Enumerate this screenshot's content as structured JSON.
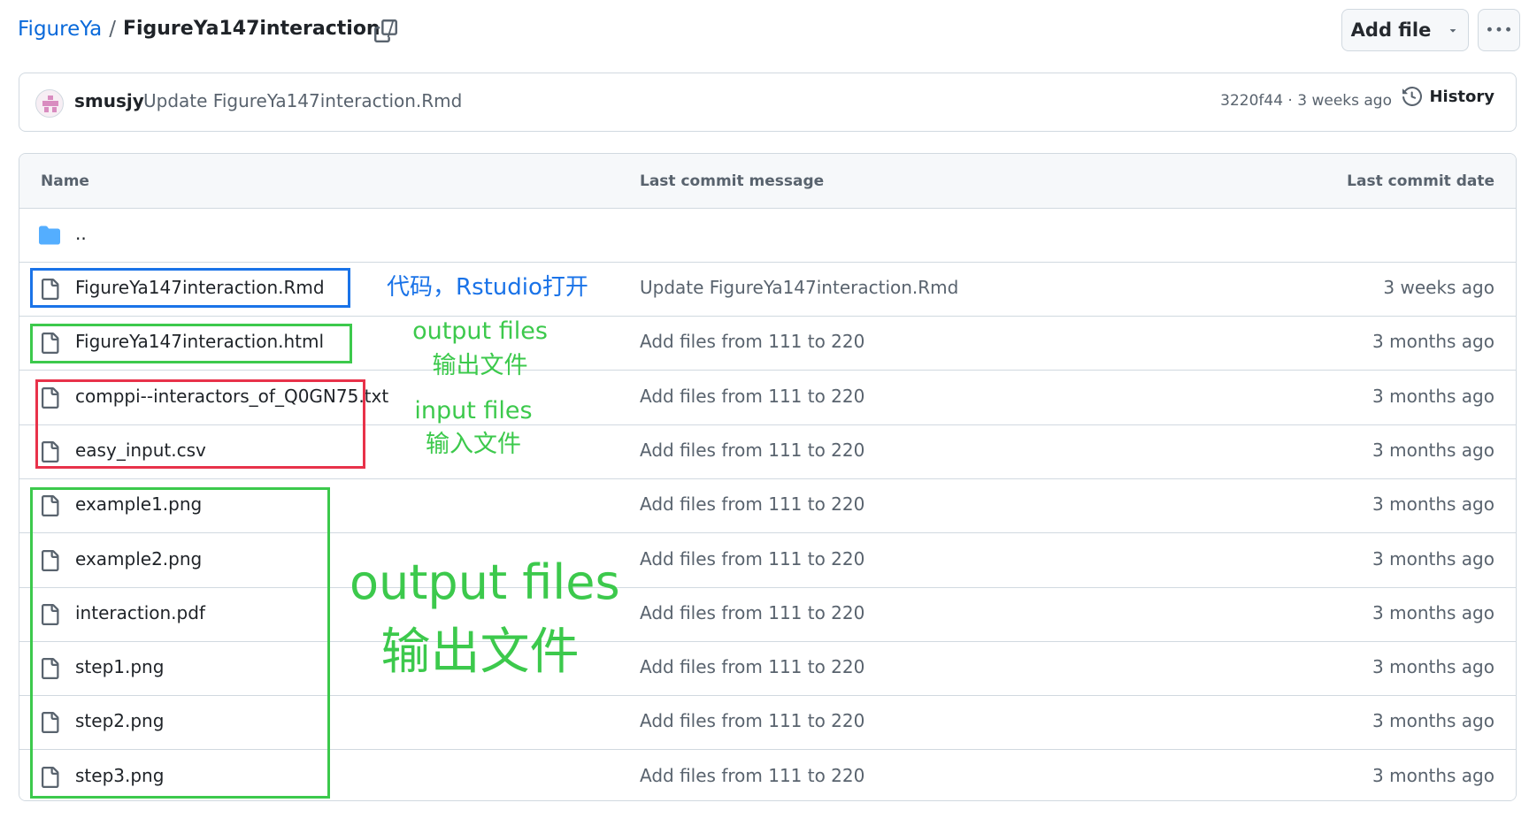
{
  "breadcrumb": {
    "repo": "FigureYa",
    "sep1": "/",
    "folder": "FigureYa147interaction",
    "sep2": "/"
  },
  "toolbar": {
    "add_file_label": "Add file",
    "copy_icon": "copy-icon",
    "more_icon": "kebab-horizontal-icon"
  },
  "latest_commit": {
    "author": "smusjy",
    "message": "Update FigureYa147interaction.Rmd",
    "meta": "3220f44 · 3 weeks ago",
    "history_label": "History"
  },
  "table": {
    "headers": {
      "name": "Name",
      "message": "Last commit message",
      "date": "Last commit date"
    },
    "parent_dir": "..",
    "rows": [
      {
        "name": "FigureYa147interaction.Rmd",
        "message": "Update FigureYa147interaction.Rmd",
        "date": "3 weeks ago"
      },
      {
        "name": "FigureYa147interaction.html",
        "message": "Add files from 111 to 220",
        "date": "3 months ago"
      },
      {
        "name": "comppi--interactors_of_Q0GN75.txt",
        "message": "Add files from 111 to 220",
        "date": "3 months ago"
      },
      {
        "name": "easy_input.csv",
        "message": "Add files from 111 to 220",
        "date": "3 months ago"
      },
      {
        "name": "example1.png",
        "message": "Add files from 111 to 220",
        "date": "3 months ago"
      },
      {
        "name": "example2.png",
        "message": "Add files from 111 to 220",
        "date": "3 months ago"
      },
      {
        "name": "interaction.pdf",
        "message": "Add files from 111 to 220",
        "date": "3 months ago"
      },
      {
        "name": "step1.png",
        "message": "Add files from 111 to 220",
        "date": "3 months ago"
      },
      {
        "name": "step2.png",
        "message": "Add files from 111 to 220",
        "date": "3 months ago"
      },
      {
        "name": "step3.png",
        "message": "Add files from 111 to 220",
        "date": "3 months ago"
      }
    ]
  },
  "annotations": {
    "code_label": "代码，Rstudio打开",
    "output_small_en": "output files",
    "output_small_zh": "输出文件",
    "input_en": "input files",
    "input_zh": "输入文件",
    "output_big_en": "output files",
    "output_big_zh": "输出文件"
  },
  "colors": {
    "link_blue": "#0969da",
    "annotation_blue": "#1a73e8",
    "annotation_green": "#3cc94c",
    "annotation_red": "#e8324a",
    "border": "#d1d9e0",
    "header_bg": "#f6f8fa"
  }
}
